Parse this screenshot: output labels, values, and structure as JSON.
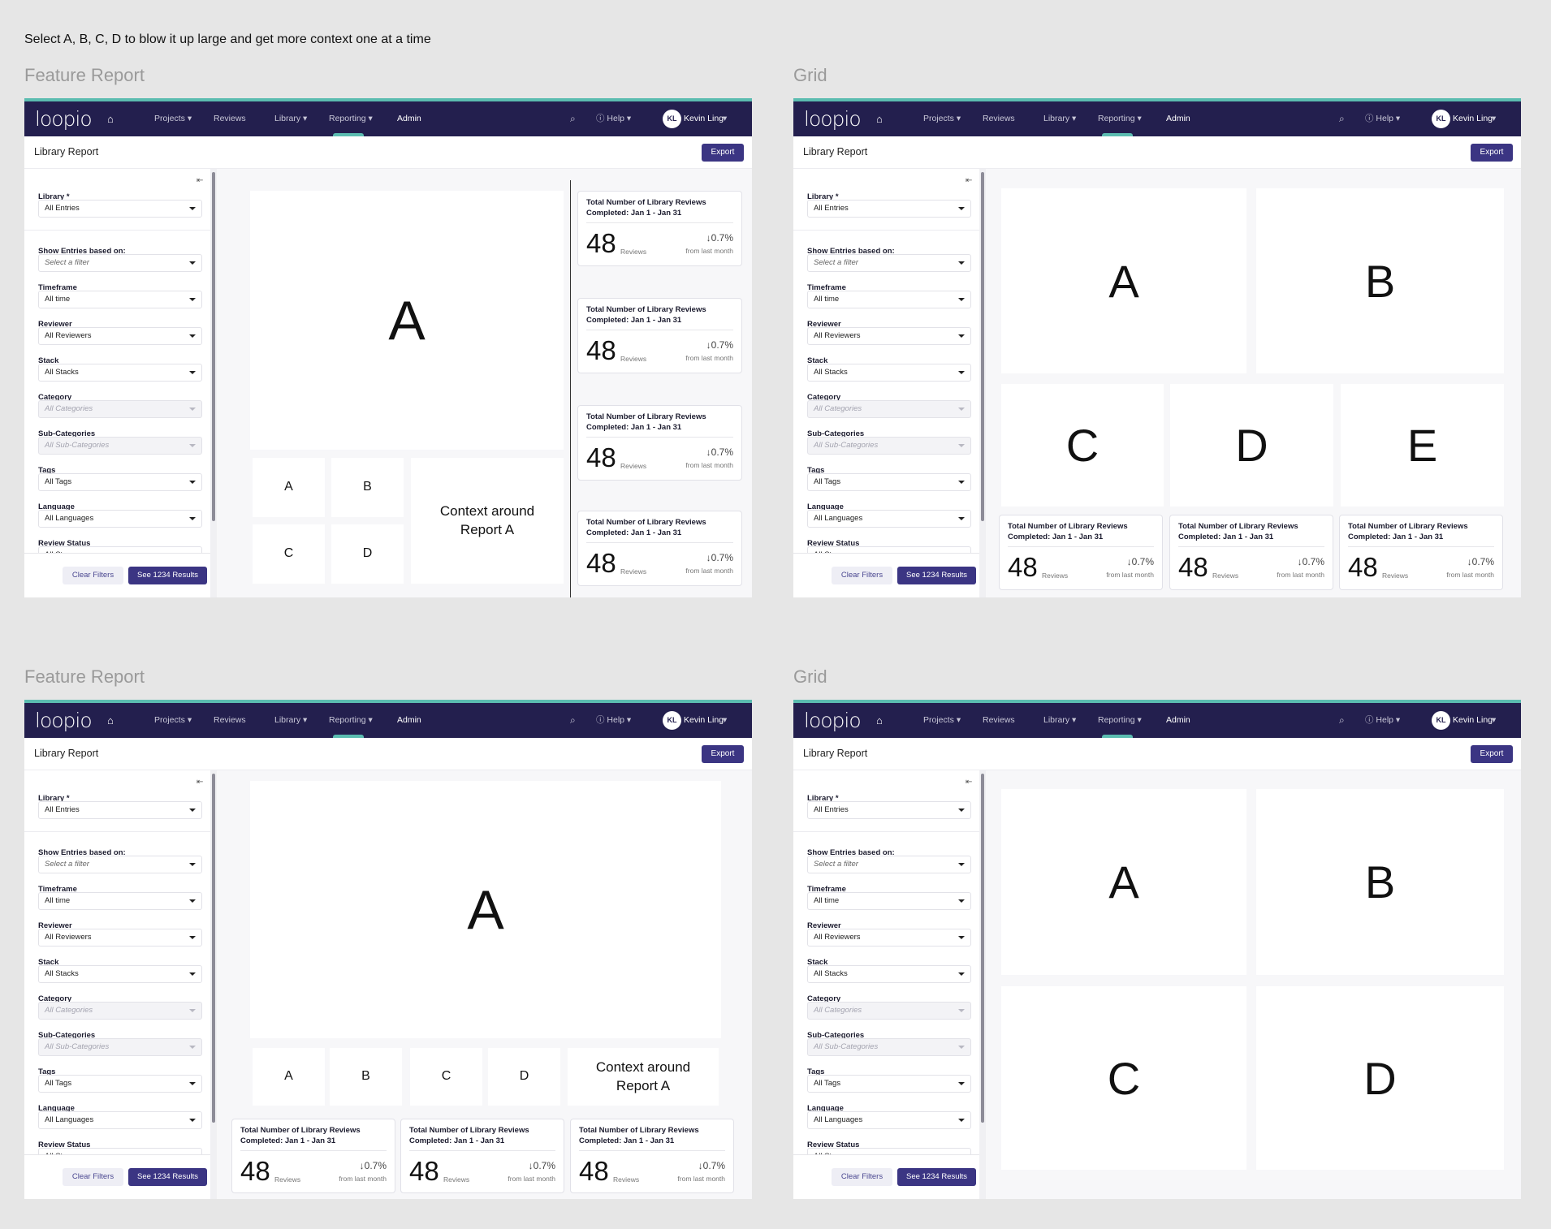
{
  "instruction": "Select A, B, C, D to blow it up large and get more context one at a time",
  "colors": {
    "nav": "#231f4e",
    "accent": "#5bbcb0",
    "primary_button": "#3b3583",
    "background": "#e6e6e6"
  },
  "app": {
    "logo": "loopio",
    "nav": {
      "home_icon": "home-icon",
      "projects": "Projects ▾",
      "reviews": "Reviews",
      "library": "Library ▾",
      "reporting": "Reporting ▾",
      "admin": "Admin",
      "search_icon": "search-icon",
      "help": "ⓘ Help ▾",
      "avatar_initials": "KL",
      "user_name": "Kevin Ling",
      "user_chevron": "▾"
    },
    "subheader": {
      "title": "Library Report",
      "export_label": "Export"
    },
    "sidebar": {
      "collapse_icon": "⇤",
      "filters": [
        {
          "label": "Library *",
          "value": "All Entries",
          "state": "normal"
        },
        {
          "label": "Show Entries based on:",
          "value": "Select a filter",
          "state": "placeholder"
        },
        {
          "label": "Timeframe",
          "value": "All time",
          "state": "normal"
        },
        {
          "label": "Reviewer",
          "value": "All Reviewers",
          "state": "normal"
        },
        {
          "label": "Stack",
          "value": "All Stacks",
          "state": "normal"
        },
        {
          "label": "Category",
          "value": "All Categories",
          "state": "disabled"
        },
        {
          "label": "Sub-Categories",
          "value": "All Sub-Categories",
          "state": "disabled"
        },
        {
          "label": "Tags",
          "value": "All Tags",
          "state": "normal"
        },
        {
          "label": "Language",
          "value": "All Languages",
          "state": "normal"
        },
        {
          "label": "Review Status",
          "value": "All Sta",
          "state": "normal"
        }
      ],
      "clear_label": "Clear Filters",
      "results_label": "See 1234 Results"
    },
    "card": {
      "title": "Total Number of Library Reviews Completed: Jan 1 - Jan 31",
      "value": "48",
      "unit": "Reviews",
      "change": "↓0.7%",
      "change_label": "from last month"
    }
  },
  "panels": [
    {
      "title": "Feature Report",
      "variant": "feature-side",
      "tiles": [
        "A",
        "A",
        "B",
        "C",
        "D",
        "Context around Report A"
      ],
      "card_count": 4
    },
    {
      "title": "Grid",
      "variant": "grid-5",
      "tiles": [
        "A",
        "B",
        "C",
        "D",
        "E"
      ],
      "card_count": 3
    },
    {
      "title": "Feature Report",
      "variant": "feature-bottom",
      "tiles": [
        "A",
        "A",
        "B",
        "C",
        "D",
        "Context around Report A"
      ],
      "card_count": 3
    },
    {
      "title": "Grid",
      "variant": "grid-4",
      "tiles": [
        "A",
        "B",
        "C",
        "D"
      ],
      "card_count": 0
    }
  ]
}
